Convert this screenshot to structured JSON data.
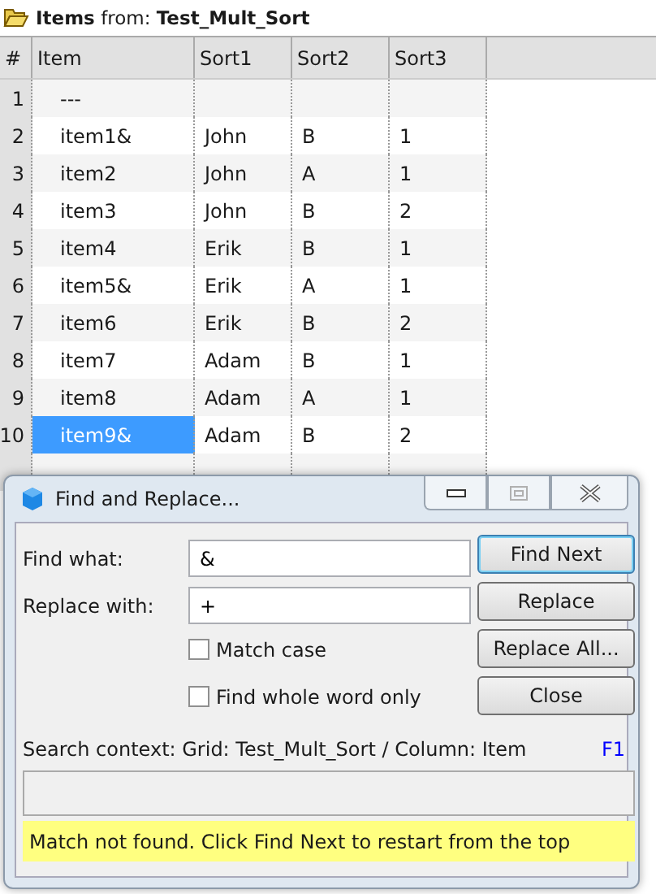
{
  "header": {
    "label": "Items",
    "from_label": "from:",
    "source": "Test_Mult_Sort"
  },
  "table": {
    "columns": [
      "#",
      "Item",
      "Sort1",
      "Sort2",
      "Sort3"
    ],
    "rows": [
      {
        "number": "1",
        "item": "---",
        "selected": false
      },
      {
        "number": "2",
        "item": "item1&",
        "sort1": "John",
        "sort2": "B",
        "sort3": "1",
        "selected": false
      },
      {
        "number": "3",
        "item": "item2",
        "sort1": "John",
        "sort2": "A",
        "sort3": "1",
        "selected": false
      },
      {
        "number": "4",
        "item": "item3",
        "sort1": "John",
        "sort2": "B",
        "sort3": "2",
        "selected": false
      },
      {
        "number": "5",
        "item": "item4",
        "sort1": "Erik",
        "sort2": "B",
        "sort3": "1",
        "selected": false
      },
      {
        "number": "6",
        "item": "item5&",
        "sort1": "Erik",
        "sort2": "A",
        "sort3": "1",
        "selected": false
      },
      {
        "number": "7",
        "item": "item6",
        "sort1": "Erik",
        "sort2": "B",
        "sort3": "2",
        "selected": false
      },
      {
        "number": "8",
        "item": "item7",
        "sort1": "Adam",
        "sort2": "B",
        "sort3": "1",
        "selected": false
      },
      {
        "number": "9",
        "item": "item8",
        "sort1": "Adam",
        "sort2": "A",
        "sort3": "1",
        "selected": false
      },
      {
        "number": "10",
        "item": "item9&",
        "sort1": "Adam",
        "sort2": "B",
        "sort3": "2",
        "selected": true
      }
    ]
  },
  "dialog": {
    "title": "Find and Replace...",
    "find": {
      "label": "Find what:",
      "value": "&"
    },
    "replace": {
      "label": "Replace with:",
      "value": "+"
    },
    "options": [
      {
        "label": "Match case",
        "checked": false
      },
      {
        "label": "Find whole word only",
        "checked": false
      }
    ],
    "buttons": [
      {
        "label": "Find Next",
        "default": true
      },
      {
        "label": "Replace",
        "default": false
      },
      {
        "label": "Replace All...",
        "default": false
      },
      {
        "label": "Close",
        "default": false
      }
    ],
    "context": "Search context: Grid: Test_Mult_Sort / Column: Item",
    "help": "F1",
    "message": "Match not found. Click Find Next to restart from the top"
  }
}
